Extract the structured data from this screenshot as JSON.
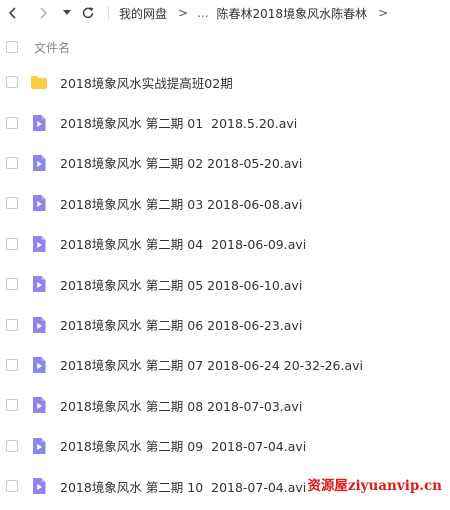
{
  "toolbar": {
    "back_icon": "chevron-left-icon",
    "forward_icon": "chevron-right-icon",
    "history_icon": "caret-down-icon",
    "refresh_icon": "refresh-icon",
    "breadcrumb": {
      "root": "我的网盘",
      "separator": ">",
      "ellipsis": "...",
      "current": "陈春林2018境象风水陈春林"
    }
  },
  "header": {
    "column_name": "文件名"
  },
  "files": [
    {
      "name": "2018境象风水实战提高班02期",
      "type": "folder"
    },
    {
      "name": "2018境象风水 第二期 01  2018.5.20.avi",
      "type": "video"
    },
    {
      "name": "2018境象风水 第二期 02 2018-05-20.avi",
      "type": "video"
    },
    {
      "name": "2018境象风水 第二期 03 2018-06-08.avi",
      "type": "video"
    },
    {
      "name": "2018境象风水 第二期 04  2018-06-09.avi",
      "type": "video"
    },
    {
      "name": "2018境象风水 第二期 05 2018-06-10.avi",
      "type": "video"
    },
    {
      "name": "2018境象风水 第二期 06 2018-06-23.avi",
      "type": "video"
    },
    {
      "name": "2018境象风水 第二期 07 2018-06-24 20-32-26.avi",
      "type": "video"
    },
    {
      "name": "2018境象风水 第二期 08 2018-07-03.avi",
      "type": "video"
    },
    {
      "name": "2018境象风水 第二期 09  2018-07-04.avi",
      "type": "video"
    },
    {
      "name": "2018境象风水 第二期 10  2018-07-04.avi",
      "type": "video"
    }
  ],
  "watermark": "资源屋ziyuanvip.cn",
  "colors": {
    "folder": "#f9cd46",
    "video": "#8d86f0",
    "watermark": "#e01b1b"
  }
}
